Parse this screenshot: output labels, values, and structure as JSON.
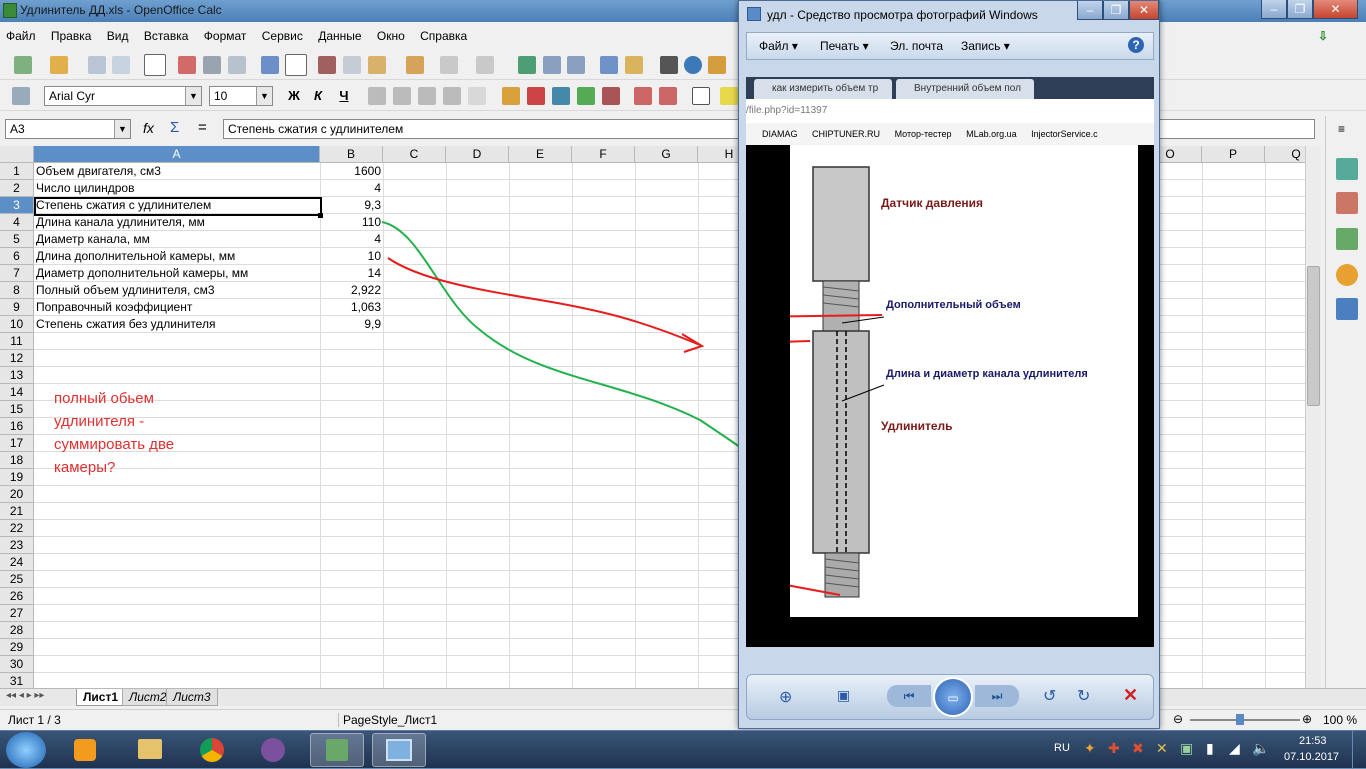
{
  "calc": {
    "title": "Удлинитель ДД.xls - OpenOffice Calc",
    "menu": [
      "Файл",
      "Правка",
      "Вид",
      "Вставка",
      "Формат",
      "Сервис",
      "Данные",
      "Окно",
      "Справка"
    ],
    "font_name": "Arial Cyr",
    "font_size": "10",
    "bold_btn": "Ж",
    "italic_btn": "К",
    "underline_btn": "Ч",
    "name_box": "A3",
    "formula_fx": "fx",
    "formula_sum": "Σ",
    "formula_eq": "=",
    "formula_text": "Степень сжатия с удлинителем",
    "columns": [
      "A",
      "B",
      "C",
      "D",
      "E",
      "F",
      "G",
      "H",
      "O",
      "P",
      "Q"
    ],
    "rows": [
      "1",
      "2",
      "3",
      "4",
      "5",
      "6",
      "7",
      "8",
      "9",
      "10",
      "11",
      "12",
      "13",
      "14",
      "15",
      "16",
      "17",
      "18",
      "19",
      "20",
      "21",
      "22",
      "23",
      "24",
      "25",
      "26",
      "27",
      "28",
      "29",
      "30",
      "31"
    ],
    "cells": [
      {
        "a": "Объем двигателя, см3",
        "b": "1600"
      },
      {
        "a": "Число цилиндров",
        "b": "4"
      },
      {
        "a": "Степень сжатия с удлинителем",
        "b": "9,3"
      },
      {
        "a": "Длина канала удлинителя, мм",
        "b": "110"
      },
      {
        "a": "Диаметр канала, мм",
        "b": "4"
      },
      {
        "a": "Длина дополнительной камеры, мм",
        "b": "10"
      },
      {
        "a": "Диаметр дополнительной камеры, мм",
        "b": "14"
      },
      {
        "a": "Полный объем удлинителя, см3",
        "b": "2,922"
      },
      {
        "a": "Поправочный коэффициент",
        "b": "1,063"
      },
      {
        "a": "Степень сжатия без удлинителя",
        "b": "9,9"
      }
    ],
    "note": "полный обьем удлинителя - суммировать две камеры?",
    "sheets": [
      "Лист1",
      "Лист2",
      "Лист3"
    ],
    "status_left": "Лист 1 / 3",
    "status_mid": "PageStyle_Лист1",
    "zoom": "100 %",
    "colors": {
      "selection": "#5c8ec8",
      "note": "#e03030",
      "green_arrow": "#22b14c",
      "red_arrow": "#e81c1c"
    }
  },
  "viewer": {
    "title": "удл - Средство просмотра фотографий Windows",
    "menu": [
      "Файл ▾",
      "Печать ▾",
      "Эл. почта",
      "Запись ▾"
    ],
    "browser_tabs": [
      "как измерить объем тр",
      "Внутренний объем пол"
    ],
    "url": "/file.php?id=11397",
    "bookmarks": [
      "DIAMAG",
      "CHIPTUNER.RU",
      "Мотор-тестер",
      "MLab.org.ua",
      "InjectorService.c"
    ],
    "labels": {
      "sensor": "Датчик давления",
      "extra_volume": "Дополнительный объем",
      "channel": "Длина и диаметр канала удлинителя",
      "extender": "Удлинитель"
    },
    "controls_icons": [
      "zoom-icon",
      "fit-icon",
      "prev-icon",
      "slideshow-icon",
      "next-icon",
      "rotate-left-icon",
      "rotate-right-icon",
      "delete-icon"
    ]
  },
  "taskbar": {
    "lang": "RU",
    "time": "21:53",
    "date": "07.10.2017"
  }
}
